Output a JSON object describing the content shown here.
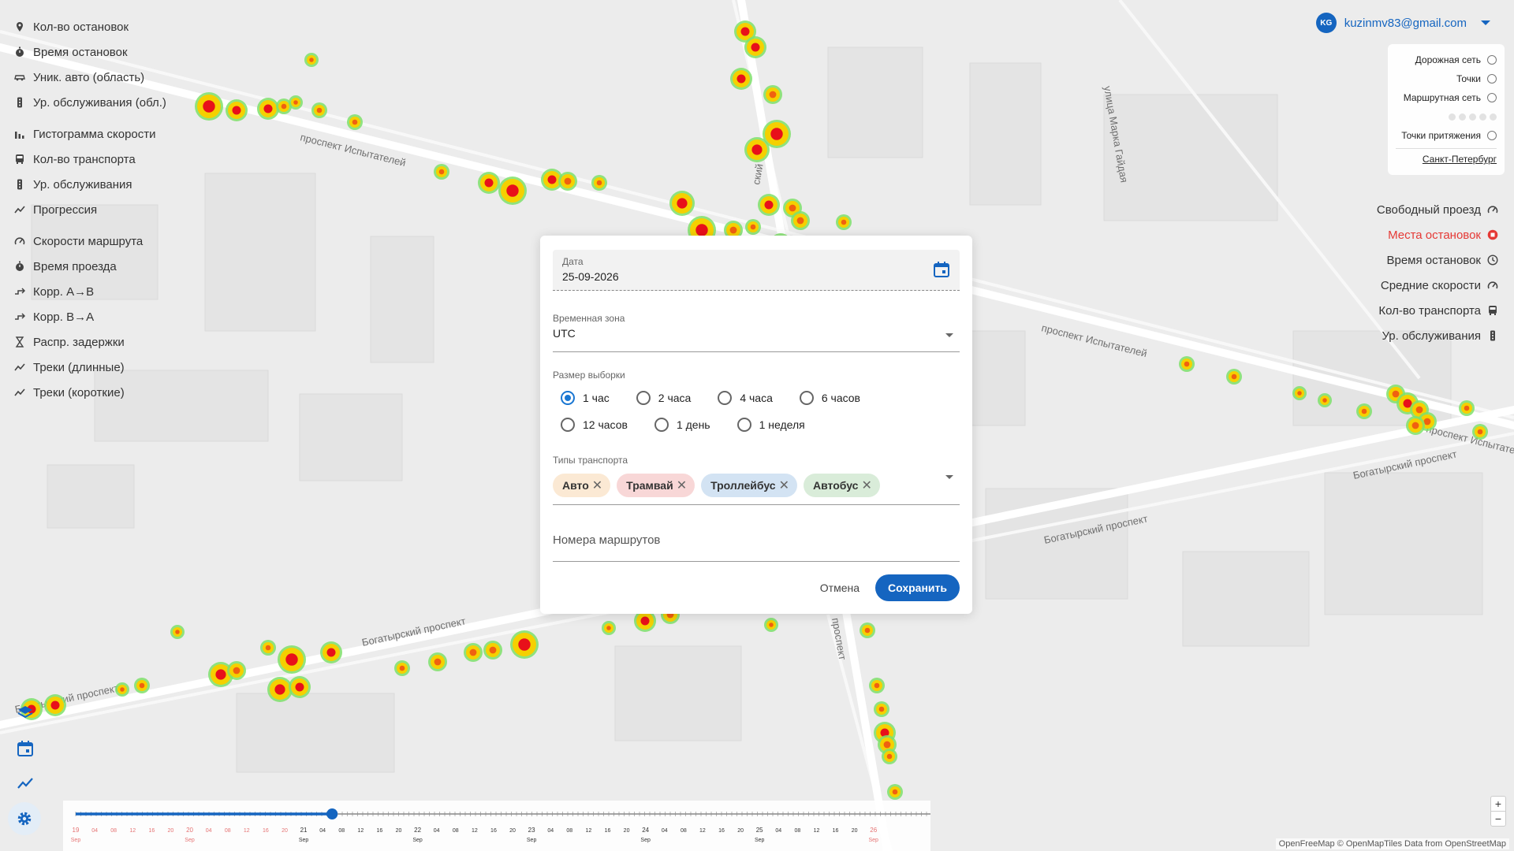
{
  "left_menu": {
    "group1": [
      {
        "label": "Кол-во остановок",
        "icon": "pin-icon"
      },
      {
        "label": "Время остановок",
        "icon": "stopwatch-icon"
      },
      {
        "label": "Уник. авто (область)",
        "icon": "car-icon"
      },
      {
        "label": "Ур. обслуживания (обл.)",
        "icon": "traffic-light-icon"
      }
    ],
    "group2": [
      {
        "label": "Гистограмма скорости",
        "icon": "bar-chart-icon"
      },
      {
        "label": "Кол-во транспорта",
        "icon": "bus-icon"
      },
      {
        "label": "Ур. обслуживания",
        "icon": "traffic-light-icon"
      },
      {
        "label": "Прогрессия",
        "icon": "trend-icon"
      }
    ],
    "group3": [
      {
        "label": "Скорости маршрута",
        "icon": "speedometer-icon"
      },
      {
        "label": "Время проезда",
        "icon": "stopwatch-icon"
      },
      {
        "label": "Корр. A→B",
        "icon": "correlation-icon"
      },
      {
        "label": "Корр. B→A",
        "icon": "correlation-icon"
      },
      {
        "label": "Распр. задержки",
        "icon": "hourglass-icon"
      },
      {
        "label": "Треки (длинные)",
        "icon": "trend-icon"
      },
      {
        "label": "Треки (короткие)",
        "icon": "trend-icon"
      }
    ]
  },
  "account": {
    "initials": "KG",
    "email": "kuzinmv83@gmail.com"
  },
  "layers": {
    "items": [
      {
        "label": "Дорожная сеть"
      },
      {
        "label": "Точки"
      },
      {
        "label": "Маршрутная сеть"
      }
    ],
    "attraction": "Точки притяжения",
    "city": "Санкт-Петербург"
  },
  "right_menu": [
    {
      "label": "Свободный проезд",
      "icon": "speedometer-icon",
      "active": false
    },
    {
      "label": "Места остановок",
      "icon": "stop-icon",
      "active": true
    },
    {
      "label": "Время остановок",
      "icon": "clock-icon",
      "active": false
    },
    {
      "label": "Средние скорости",
      "icon": "speedometer-icon",
      "active": false
    },
    {
      "label": "Кол-во транспорта",
      "icon": "bus-icon",
      "active": false
    },
    {
      "label": "Ур. обслуживания",
      "icon": "traffic-light-icon",
      "active": false
    }
  ],
  "modal": {
    "date_label": "Дата",
    "date_value": "25-09-2026",
    "timezone_label": "Временная зона",
    "timezone_value": "UTC",
    "sample_label": "Размер выборки",
    "sample_options": [
      "1 час",
      "2 часа",
      "4 часа",
      "6 часов",
      "12 часов",
      "1 день",
      "1 неделя"
    ],
    "sample_selected": "1 час",
    "transport_label": "Типы транспорта",
    "transport_chips": [
      {
        "label": "Авто",
        "color": "#fbe9d4"
      },
      {
        "label": "Трамвай",
        "color": "#f8d7d7"
      },
      {
        "label": "Троллейбус",
        "color": "#d3e3f3"
      },
      {
        "label": "Автобус",
        "color": "#d9ecd9"
      }
    ],
    "routes_placeholder": "Номера маршрутов",
    "cancel_label": "Отмена",
    "save_label": "Сохранить"
  },
  "map": {
    "street_labels": [
      "проспект Испытателей",
      "проспект Испытателей",
      "проспект Испытателей",
      "Богатырский проспект",
      "Богатырский проспект",
      "Богатырский проспект",
      "улица Марка Гайдая",
      "Богатырский проспект",
      "ский",
      "проспект"
    ]
  },
  "timeline": {
    "day_labels": [
      "19",
      "20",
      "21",
      "22",
      "23",
      "24",
      "25",
      "26"
    ],
    "month_label": "Sep",
    "hour_labels": [
      "04",
      "08",
      "12",
      "16",
      "20"
    ],
    "progress": 0.3
  },
  "zoom": {
    "plus": "+",
    "minus": "−"
  },
  "attribution": "OpenFreeMap © OpenMapTiles Data from OpenStreetMap",
  "colors": {
    "accent": "#1565c0",
    "active": "#e53935"
  }
}
